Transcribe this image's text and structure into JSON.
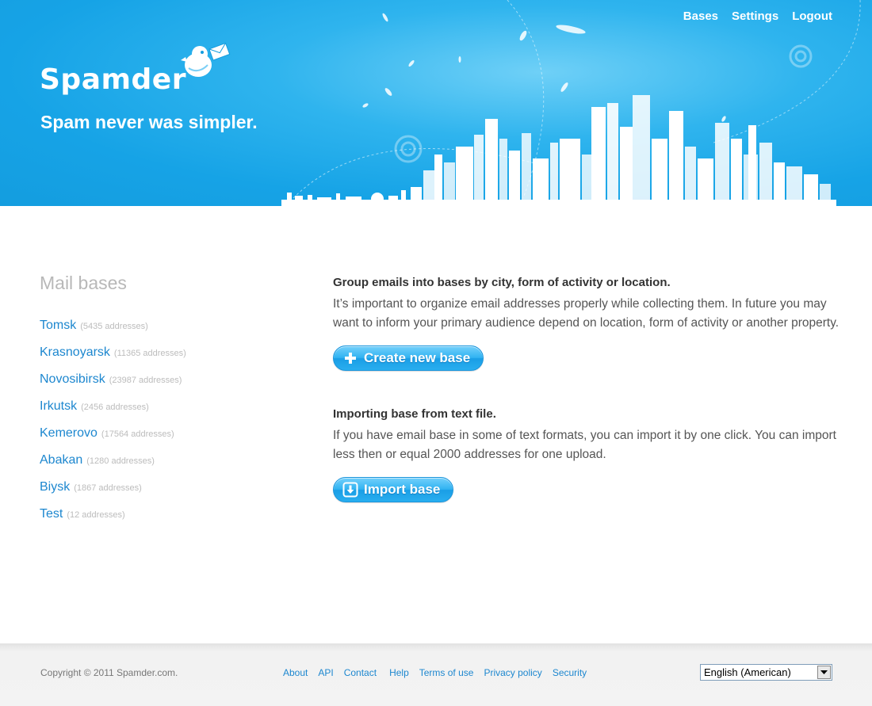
{
  "header": {
    "logo": "Spamder",
    "tagline": "Spam never was simpler.",
    "nav": [
      {
        "label": "Bases"
      },
      {
        "label": "Settings"
      },
      {
        "label": "Logout"
      }
    ],
    "colors": {
      "sky": "#16a3e6",
      "sky_light": "#6fd0f7"
    }
  },
  "sidebar": {
    "title": "Mail bases",
    "bases": [
      {
        "name": "Tomsk",
        "count": "(5435 addresses)"
      },
      {
        "name": "Krasnoyarsk",
        "count": "(11365 addresses)"
      },
      {
        "name": "Novosibirsk",
        "count": "(23987 addresses)"
      },
      {
        "name": "Irkutsk",
        "count": "(2456 addresses)"
      },
      {
        "name": "Kemerovo",
        "count": "(17564 addresses)"
      },
      {
        "name": "Abakan",
        "count": "(1280 addresses)"
      },
      {
        "name": "Biysk",
        "count": "(1867 addresses)"
      },
      {
        "name": "Test",
        "count": "(12 addresses)"
      }
    ]
  },
  "main": {
    "group": {
      "heading": "Group emails into bases by city, form of activity or location.",
      "text": "It’s important to organize email addresses properly while collecting them. In future you may want to inform your primary audience depend on location, form of activity or another property.",
      "button": "Create new base",
      "button_icon": "plus-icon"
    },
    "import": {
      "heading": "Importing base from text file.",
      "text": "If you have email base in some of text formats, you can import it by one click. You can import less then or equal 2000 addresses for one upload.",
      "button": "Import base",
      "button_icon": "download-icon"
    }
  },
  "footer": {
    "copyright": "Copyright © 2011 Spamder.com.",
    "links": [
      "About",
      "API",
      "Contact",
      "Help",
      "Terms of use",
      "Privacy policy",
      "Security"
    ],
    "language": "English (American)"
  },
  "colors": {
    "link": "#1d87cf",
    "button": "#31b3f2"
  }
}
